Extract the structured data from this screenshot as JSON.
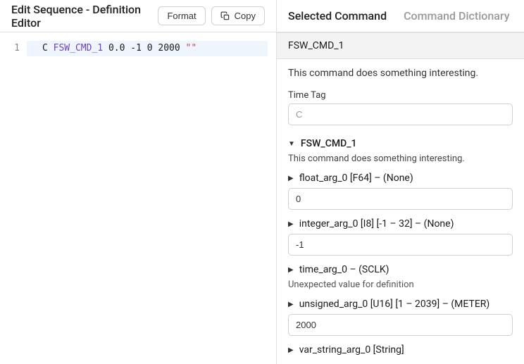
{
  "left": {
    "title": "Edit Sequence - Definition Editor",
    "format_label": "Format",
    "copy_label": "Copy",
    "gutter": {
      "line1": "1"
    },
    "code": {
      "time_tag": "C",
      "cmd": "FSW_CMD_1",
      "arg0": "0.0",
      "arg1": "-1",
      "arg2": "0",
      "arg3": "2000",
      "arg4": "\"\""
    }
  },
  "tabs": {
    "selected": "Selected Command",
    "dictionary": "Command Dictionary"
  },
  "detail": {
    "cmd_name": "FSW_CMD_1",
    "description": "This command does something interesting.",
    "time_tag_label": "Time Tag",
    "time_tag_value": "C",
    "cmd_section_name": "FSW_CMD_1",
    "cmd_section_desc": "This command does something interesting.",
    "args": {
      "float": {
        "label": "float_arg_0 [F64] – (None)",
        "value": "0"
      },
      "integer": {
        "label": "integer_arg_0 [I8] [-1 – 32] – (None)",
        "value": "-1"
      },
      "time": {
        "label": "time_arg_0 – (SCLK)",
        "note": "Unexpected value for definition"
      },
      "unsigned": {
        "label": "unsigned_arg_0 [U16] [1 – 2039] – (METER)",
        "value": "2000"
      },
      "var_string": {
        "label": "var_string_arg_0 [String]"
      }
    }
  }
}
